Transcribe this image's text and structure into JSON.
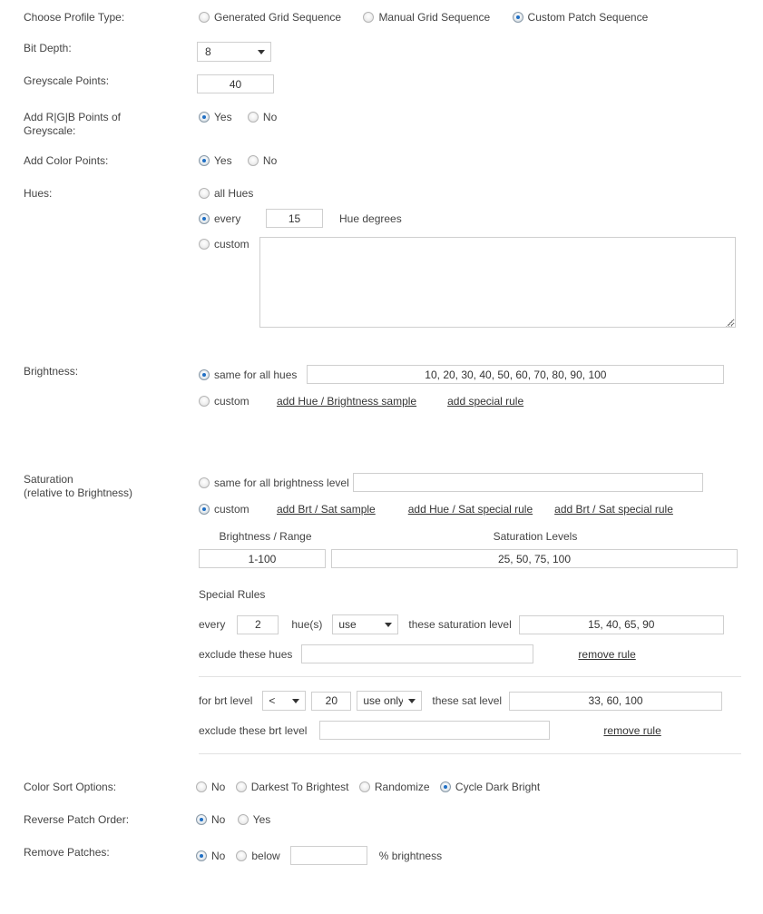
{
  "profile_type": {
    "label": "Choose Profile Type:",
    "options": [
      {
        "label": "Generated Grid Sequence",
        "selected": false
      },
      {
        "label": "Manual Grid Sequence",
        "selected": false
      },
      {
        "label": "Custom Patch Sequence",
        "selected": true
      }
    ]
  },
  "bit_depth": {
    "label": "Bit Depth:",
    "value": "8"
  },
  "greyscale_points": {
    "label": "Greyscale Points:",
    "value": "40"
  },
  "rgb_points": {
    "label_line1": "Add R|G|B Points of",
    "label_line2": "Greyscale:",
    "yes": "Yes",
    "no": "No",
    "selected": "Yes"
  },
  "color_points": {
    "label": "Add Color Points:",
    "yes": "Yes",
    "no": "No",
    "selected": "Yes"
  },
  "hues": {
    "label": "Hues:",
    "all_label": "all Hues",
    "every_label": "every",
    "every_value": "15",
    "degrees_label": "Hue degrees",
    "custom_label": "custom",
    "custom_value": "",
    "selected": "every"
  },
  "brightness": {
    "label": "Brightness:",
    "same_label": "same for all hues",
    "same_value": "10, 20, 30, 40, 50, 60, 70, 80, 90, 100",
    "custom_label": "custom",
    "link_sample": "add Hue / Brightness sample",
    "link_special": "add special rule",
    "selected": "same"
  },
  "saturation": {
    "label_line1": "Saturation",
    "label_line2": "(relative to Brightness)",
    "same_label": "same for all brightness level",
    "same_value": "",
    "custom_label": "custom",
    "link_sample": "add Brt / Sat sample",
    "link_hue_rule": "add Hue / Sat special rule",
    "link_brt_rule": "add Brt / Sat special rule",
    "selected": "custom",
    "table": {
      "header_brightness": "Brightness / Range",
      "header_saturation": "Saturation Levels",
      "brightness_value": "1-100",
      "saturation_value": "25, 50, 75, 100"
    },
    "special_rules_title": "Special Rules",
    "rules": [
      {
        "prefix": "every",
        "count": "2",
        "unit": "hue(s)",
        "mode": "use",
        "mode_options": [
          "use",
          "use only"
        ],
        "suffix": "these saturation level",
        "levels": "15, 40, 65, 90",
        "exclude_label": "exclude these hues",
        "exclude_value": "",
        "remove_label": "remove rule"
      },
      {
        "prefix": "for brt level",
        "comparator": "<",
        "comparator_options": [
          "<",
          ">",
          "="
        ],
        "count": "20",
        "mode": "use only",
        "mode_options": [
          "use",
          "use only"
        ],
        "suffix": "these sat level",
        "levels": "33, 60, 100",
        "exclude_label": "exclude these brt level",
        "exclude_value": "",
        "remove_label": "remove rule"
      }
    ]
  },
  "color_sort": {
    "label": "Color Sort Options:",
    "options": [
      {
        "label": "No",
        "selected": false
      },
      {
        "label": "Darkest To Brightest",
        "selected": false
      },
      {
        "label": "Randomize",
        "selected": false
      },
      {
        "label": "Cycle Dark Bright",
        "selected": true
      }
    ]
  },
  "reverse_order": {
    "label": "Reverse Patch Order:",
    "options": [
      {
        "label": "No",
        "selected": true
      },
      {
        "label": "Yes",
        "selected": false
      }
    ]
  },
  "remove_patches": {
    "label": "Remove Patches:",
    "no_label": "No",
    "below_label": "below",
    "below_value": "",
    "suffix": "% brightness",
    "selected": "No"
  }
}
